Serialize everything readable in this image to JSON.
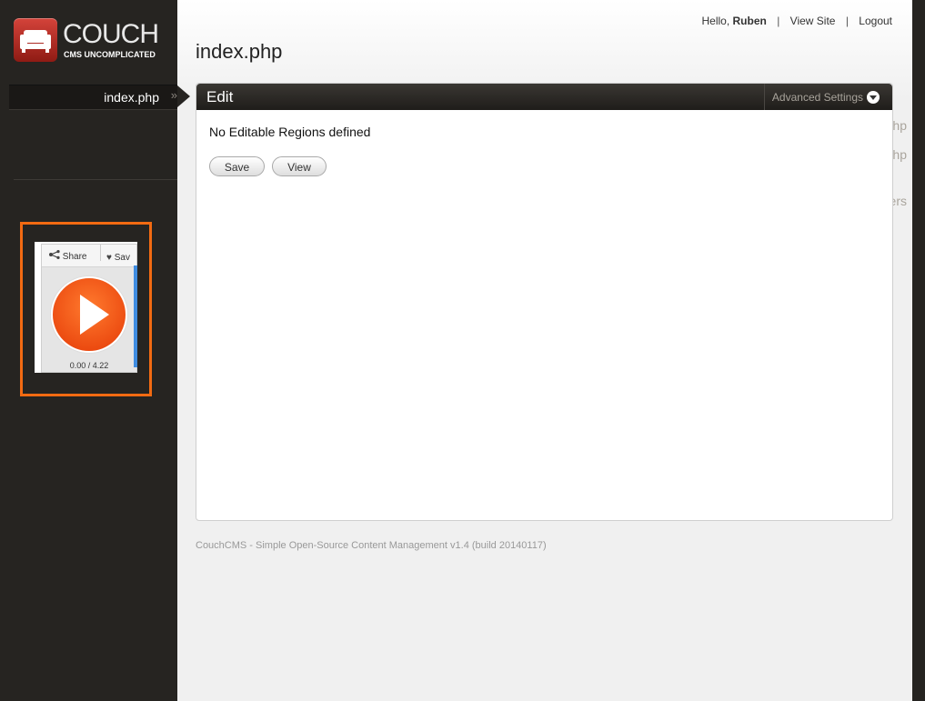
{
  "brand": {
    "name": "COUCH",
    "tagline": "CMS UNCOMPLICATED"
  },
  "header": {
    "greeting": "Hello,",
    "user": "Ruben",
    "sep": "|",
    "view_site": "View Site",
    "logout": "Logout"
  },
  "sidebar": {
    "items": [
      {
        "label": "index.php",
        "active": true,
        "chevron": "»"
      },
      {
        "label": "artigo.php",
        "icon": "folder-icon"
      },
      {
        "label": "categoria.php"
      }
    ],
    "users": {
      "label": "Users",
      "icon": "user-icon"
    }
  },
  "widget": {
    "share": "Share",
    "save": "Sav",
    "time": "0.00 / 4.22",
    "accent": "#f26a12"
  },
  "page": {
    "title": "index.php"
  },
  "panel": {
    "title": "Edit",
    "advanced": "Advanced Settings",
    "message": "No Editable Regions defined",
    "save_label": "Save",
    "view_label": "View"
  },
  "footer": {
    "text": "CouchCMS - Simple Open-Source Content Management v1.4 (build 20140117)"
  },
  "colors": {
    "sidebar_bg": "#262421",
    "brand_red": "#c0392b",
    "widget_orange": "#f26a12"
  }
}
